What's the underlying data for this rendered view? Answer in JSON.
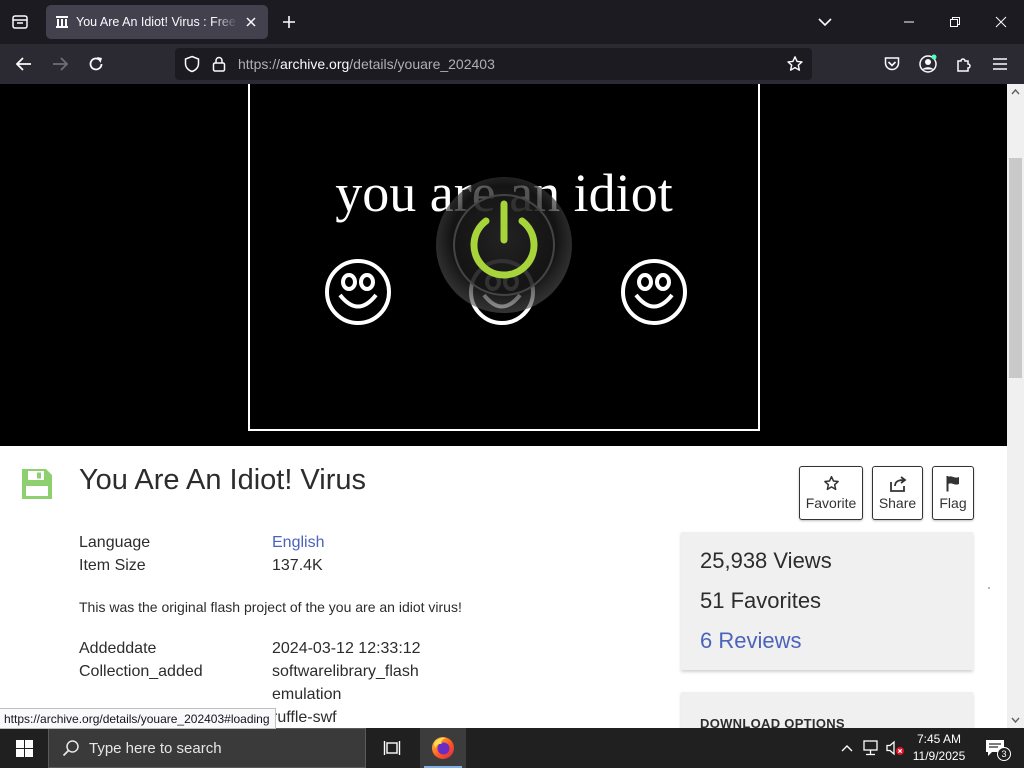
{
  "browser": {
    "tab": {
      "title": "You Are An Idiot! Virus : Free Download, Borrow, and Streaming : Internet Archive"
    },
    "url": {
      "prefix": "https://",
      "domain": "archive.org",
      "path": "/details/youare_202403"
    },
    "link_preview": "https://archive.org/details/youare_202403#loading"
  },
  "player": {
    "flash_text": "you are an idiot"
  },
  "item": {
    "title": "You Are An Idiot! Virus",
    "actions": {
      "favorite": "Favorite",
      "share": "Share",
      "flag": "Flag"
    },
    "metadata": {
      "language_label": "Language",
      "language_value": "English",
      "size_label": "Item Size",
      "size_value": "137.4K",
      "description": "This was the original flash project of the you are an idiot virus!",
      "added_label": "Addeddate",
      "added_value": "2024-03-12 12:33:12",
      "collection_label": "Collection_added",
      "collection_values": [
        "softwarelibrary_flash",
        "emulation",
        "ruffle-swf"
      ]
    },
    "stats": {
      "views": "25,938 Views",
      "favorites": "51 Favorites",
      "reviews": "6 Reviews"
    },
    "download_heading": "DOWNLOAD OPTIONS"
  },
  "taskbar": {
    "search_placeholder": "Type here to search",
    "time": "7:45 AM",
    "date": "11/9/2025",
    "notification_count": "3"
  },
  "colors": {
    "tabbar_bg": "#1c1b22",
    "navbar_bg": "#2b2a33",
    "link_blue": "#4b64ba",
    "floppy_green": "#8ecf6f",
    "taskbar_bg": "#202020"
  }
}
